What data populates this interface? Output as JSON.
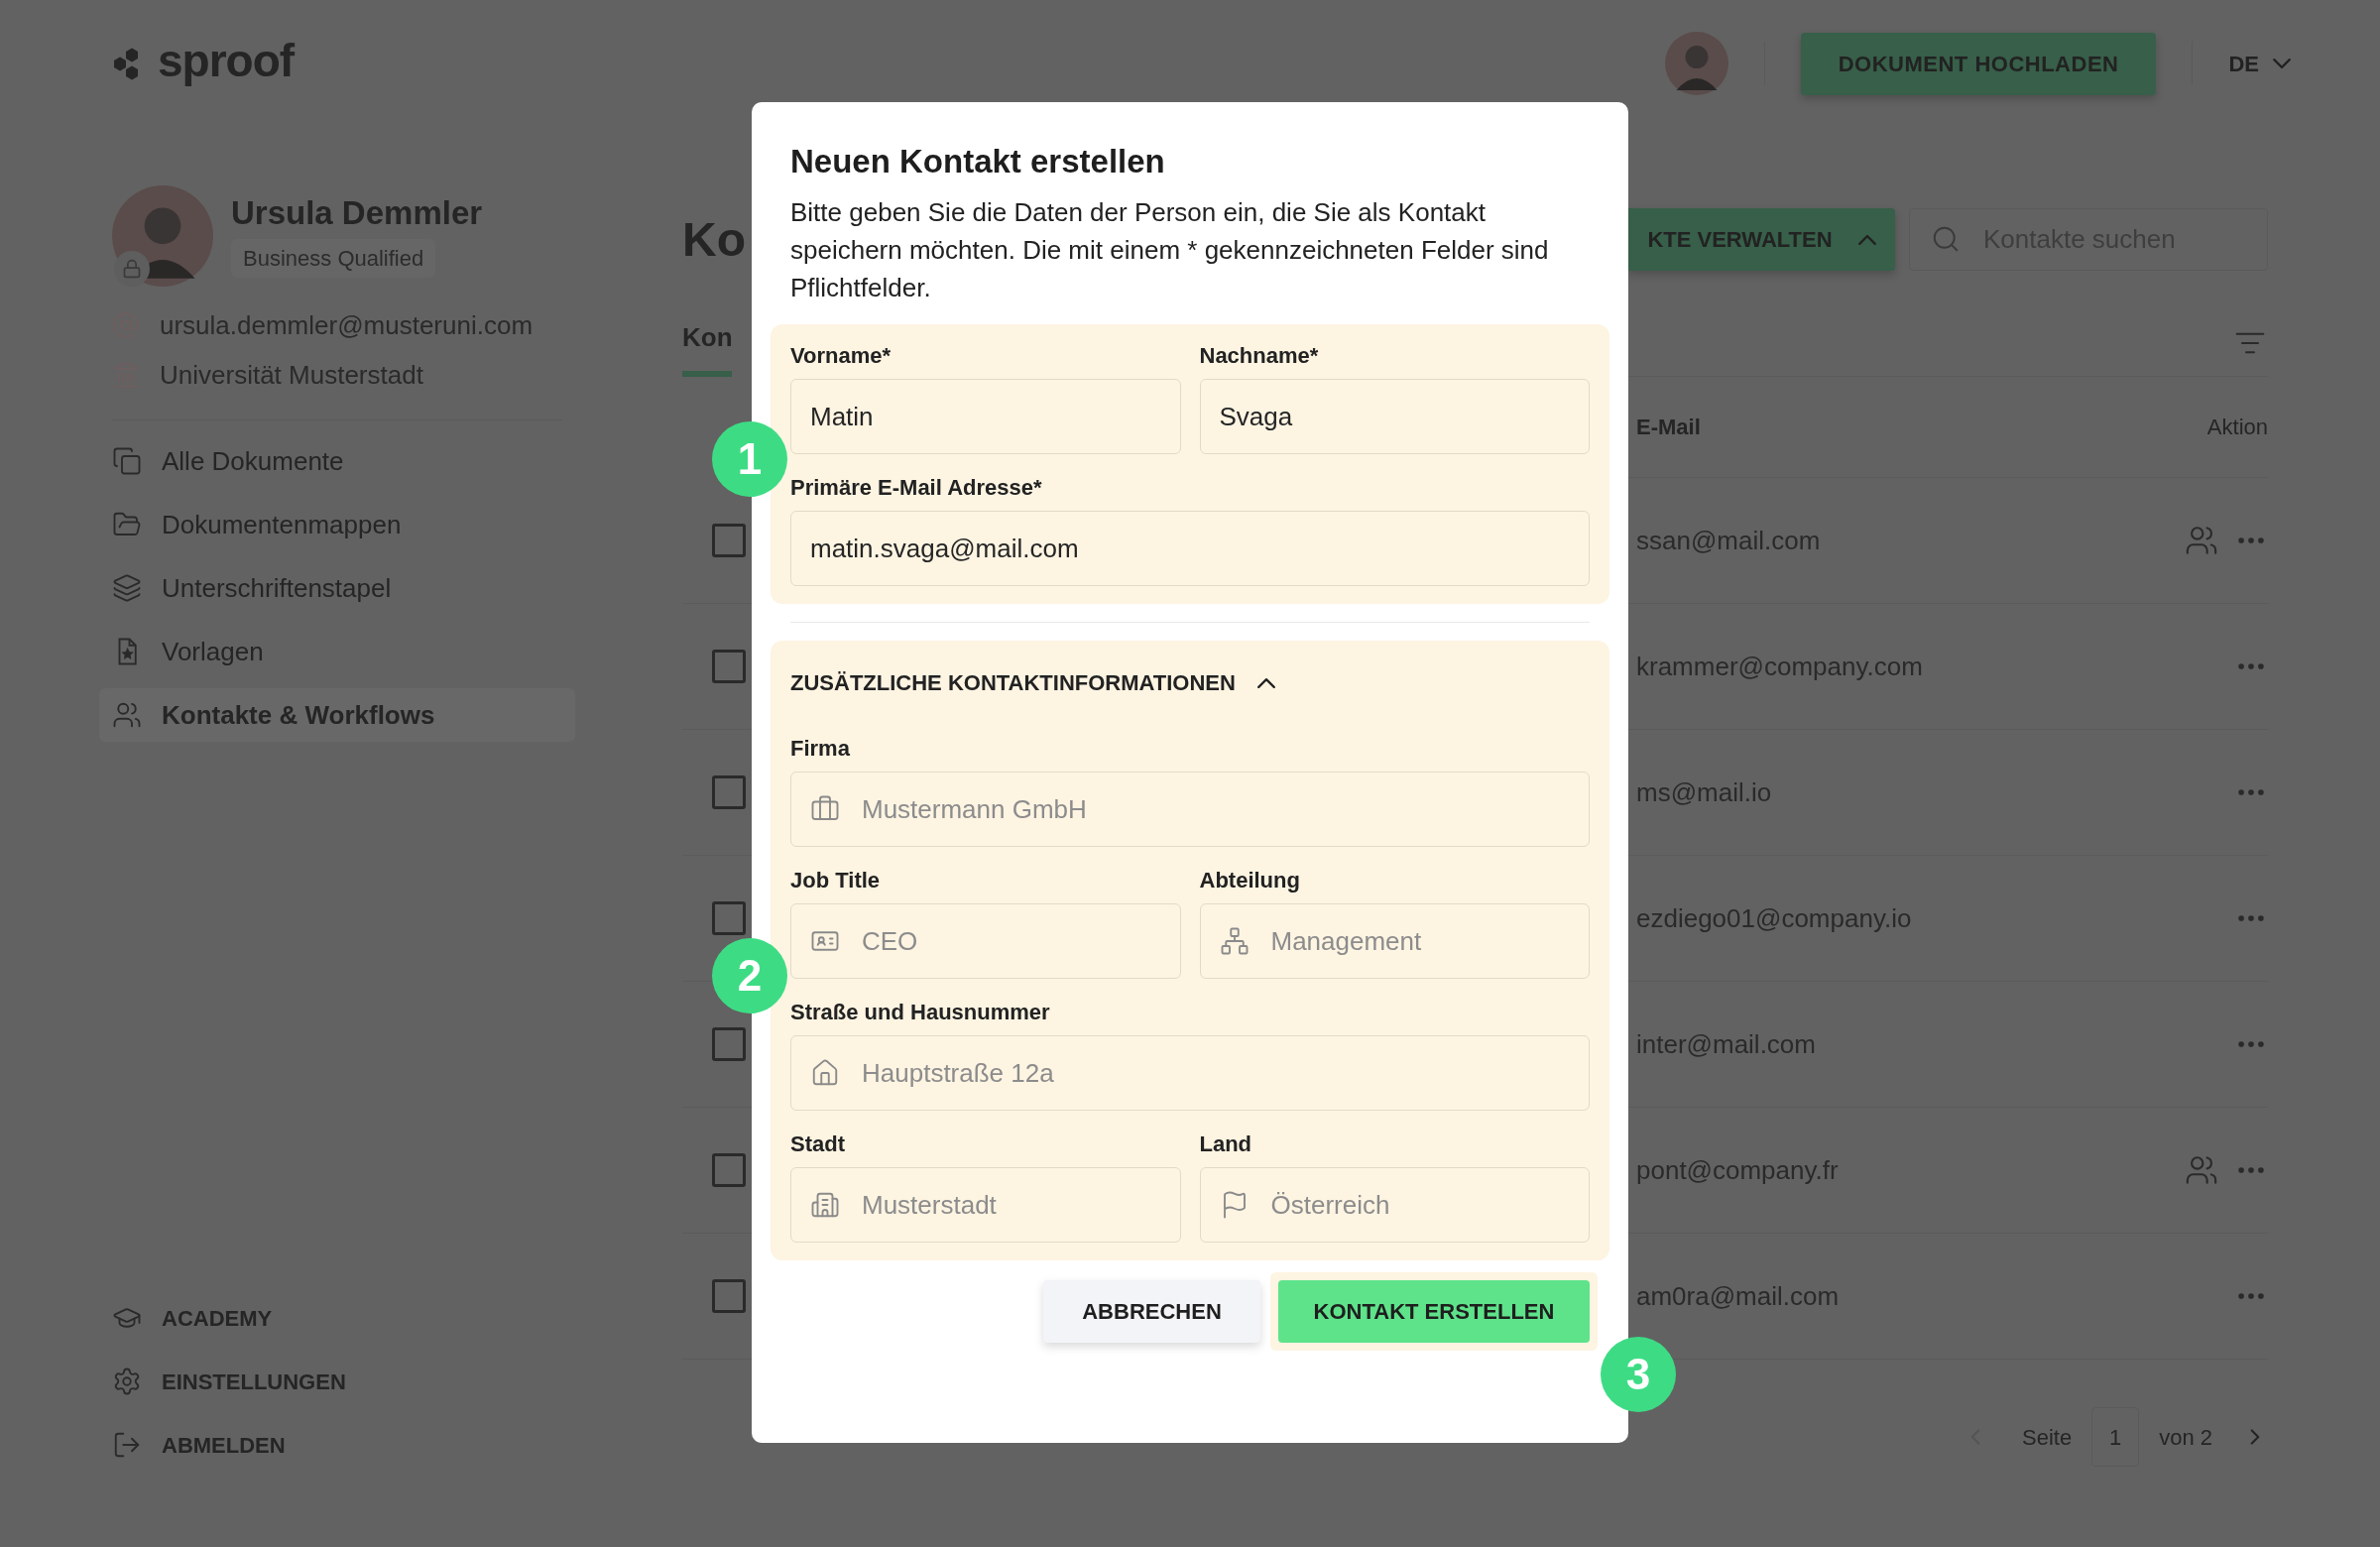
{
  "logo": {
    "text": "sproof"
  },
  "header": {
    "upload_button": "DOKUMENT HOCHLADEN",
    "language": "DE"
  },
  "profile": {
    "name": "Ursula Demmler",
    "badge": "Business Qualified",
    "email": "ursula.demmler@musteruni.com",
    "organization": "Universität Musterstadt"
  },
  "nav": [
    {
      "label": "Alle Dokumente",
      "selected": false
    },
    {
      "label": "Dokumentenmappen",
      "selected": false
    },
    {
      "label": "Unterschriftenstapel",
      "selected": false
    },
    {
      "label": "Vorlagen",
      "selected": false
    },
    {
      "label": "Kontakte & Workflows",
      "selected": true
    }
  ],
  "footer_nav": [
    "ACADEMY",
    "EINSTELLUNGEN",
    "ABMELDEN"
  ],
  "main": {
    "title": "Ko",
    "tab": "Kon",
    "manage_button": "KTE VERWALTEN",
    "search": {
      "placeholder": "Kontakte suchen"
    },
    "columns": [
      "E-Mail",
      "Aktion"
    ],
    "rows": [
      {
        "checked": false,
        "email": "ssan@mail.com",
        "shared": true
      },
      {
        "checked": false,
        "email": "krammer@company.com",
        "shared": false
      },
      {
        "checked": false,
        "email": "ms@mail.io",
        "shared": false
      },
      {
        "checked": false,
        "email": "ezdiego01@company.io",
        "shared": false
      },
      {
        "checked": false,
        "email": "inter@mail.com",
        "shared": false
      },
      {
        "checked": false,
        "email": "pont@company.fr",
        "shared": true
      },
      {
        "checked": false,
        "email": "am0ra@mail.com",
        "shared": false
      }
    ],
    "pagination": {
      "label": "Seite",
      "page": "1",
      "total": "von 2"
    }
  },
  "dialog": {
    "title": "Neuen Kontakt erstellen",
    "description": "Bitte geben Sie die Daten der Person ein, die Sie als Kontakt speichern möchten. Die mit einem * gekennzeichneten Felder sind Pflichtfelder.",
    "required_rows": [
      [
        {
          "label": "Vorname*",
          "value": "Matin"
        },
        {
          "label": "Nachname*",
          "value": "Svaga"
        }
      ],
      [
        {
          "label": "Primäre E-Mail Adresse*",
          "value": "matin.svaga@mail.com"
        }
      ]
    ],
    "section": {
      "title": "ZUSÄTZLICHE KONTAKTINFORMATIONEN",
      "expanded": true,
      "rows": [
        [
          {
            "label": "Firma",
            "placeholder": "Mustermann GmbH"
          }
        ],
        [
          {
            "label": "Job Title",
            "placeholder": "CEO"
          },
          {
            "label": "Abteilung",
            "placeholder": "Management"
          }
        ],
        [
          {
            "label": "Straße und Hausnummer",
            "placeholder": "Hauptstraße 12a"
          }
        ],
        [
          {
            "label": "Stadt",
            "placeholder": "Musterstadt"
          },
          {
            "label": "Land",
            "placeholder": "Österreich"
          }
        ]
      ]
    },
    "cancel_button": "ABBRECHEN",
    "confirm_button": "KONTAKT ERSTELLEN"
  },
  "callouts": [
    "1",
    "2",
    "3"
  ]
}
